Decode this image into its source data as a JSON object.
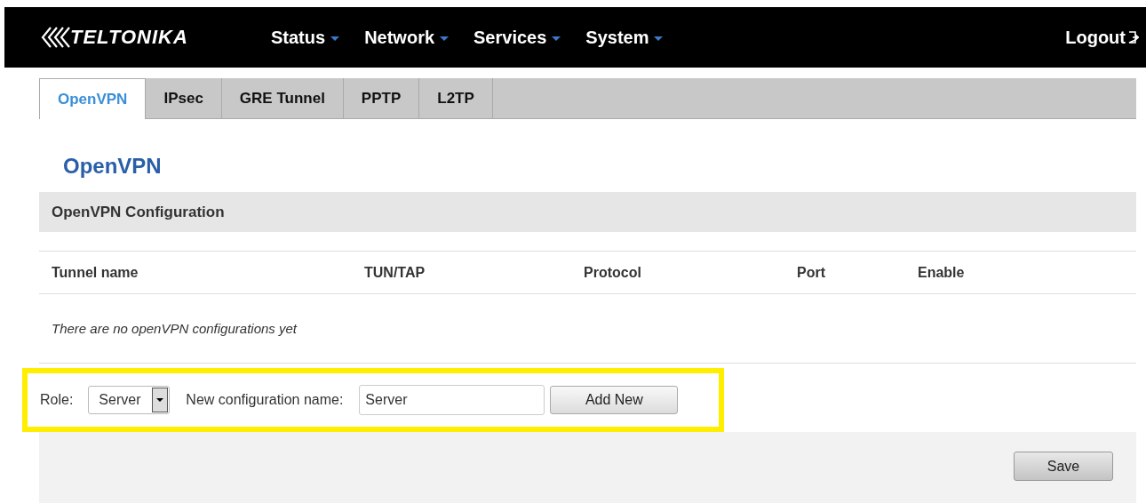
{
  "header": {
    "logo": "TELTONIKA",
    "menu": [
      {
        "label": "Status"
      },
      {
        "label": "Network"
      },
      {
        "label": "Services"
      },
      {
        "label": "System"
      }
    ],
    "logout": "Logout"
  },
  "tabs": [
    {
      "label": "OpenVPN",
      "selected": true
    },
    {
      "label": "IPsec",
      "selected": false
    },
    {
      "label": "GRE Tunnel",
      "selected": false
    },
    {
      "label": "PPTP",
      "selected": false
    },
    {
      "label": "L2TP",
      "selected": false
    }
  ],
  "page_title": "OpenVPN",
  "section": {
    "title": "OpenVPN Configuration",
    "columns": [
      "Tunnel name",
      "TUN/TAP",
      "Protocol",
      "Port",
      "Enable"
    ],
    "empty_message": "There are no openVPN configurations yet"
  },
  "add_form": {
    "highlighted": true,
    "role_label": "Role:",
    "role_value": "Server",
    "name_label": "New configuration name:",
    "name_value": "Server",
    "button": "Add New"
  },
  "save_button": "Save"
}
